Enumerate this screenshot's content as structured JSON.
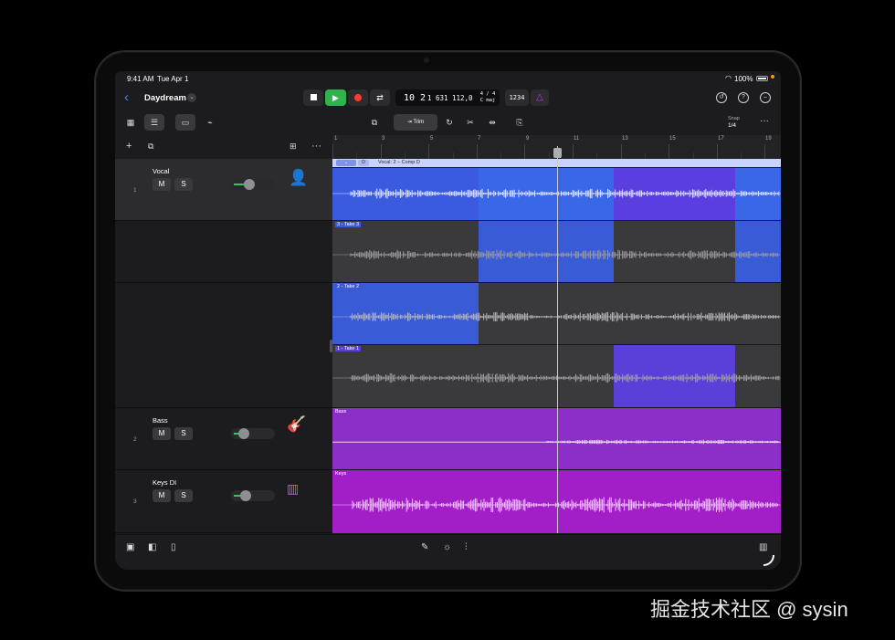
{
  "status": {
    "time": "9:41 AM",
    "date": "Tue Apr 1",
    "battery": "100%"
  },
  "project": {
    "name": "Daydream"
  },
  "transport": {
    "position": "10 2",
    "ticks": "1 631",
    "tempo": "112,0",
    "time_signature": "4 / 4",
    "key": "C maj",
    "count_in": "1234"
  },
  "toolbar": {
    "trim_label": "Trim",
    "snap_label": "Snap",
    "snap_value": "1/4"
  },
  "ruler": {
    "bars": [
      "1",
      "3",
      "5",
      "7",
      "9",
      "11",
      "13",
      "15",
      "17",
      "19"
    ]
  },
  "tracks": [
    {
      "number": "1",
      "name": "Vocal",
      "mute": "M",
      "solo": "S",
      "icon": "vocal-icon"
    },
    {
      "number": "2",
      "name": "Bass",
      "mute": "M",
      "solo": "S",
      "icon": "bass-guitar-icon"
    },
    {
      "number": "3",
      "name": "Keys DI",
      "mute": "M",
      "solo": "S",
      "icon": "keyboard-icon"
    }
  ],
  "regions": {
    "comp_header": "Vocal: 2 – Comp D",
    "comp_badge": "D",
    "take3": "3 - Take 3",
    "take2": "2 - Take 2",
    "take1": "1 - Take 1",
    "bass": "Bass",
    "keys": "Keys"
  },
  "colors": {
    "comp_blue": "#3a5ae0",
    "take_blue": "#3a5bd6",
    "take_violet": "#5b3fd8",
    "bass_purple": "#8b2fc6",
    "keys_magenta": "#a21fc8",
    "play_green": "#2fb34a",
    "record_red": "#ff3b30"
  },
  "watermark": "掘金技术社区 @ sysin"
}
